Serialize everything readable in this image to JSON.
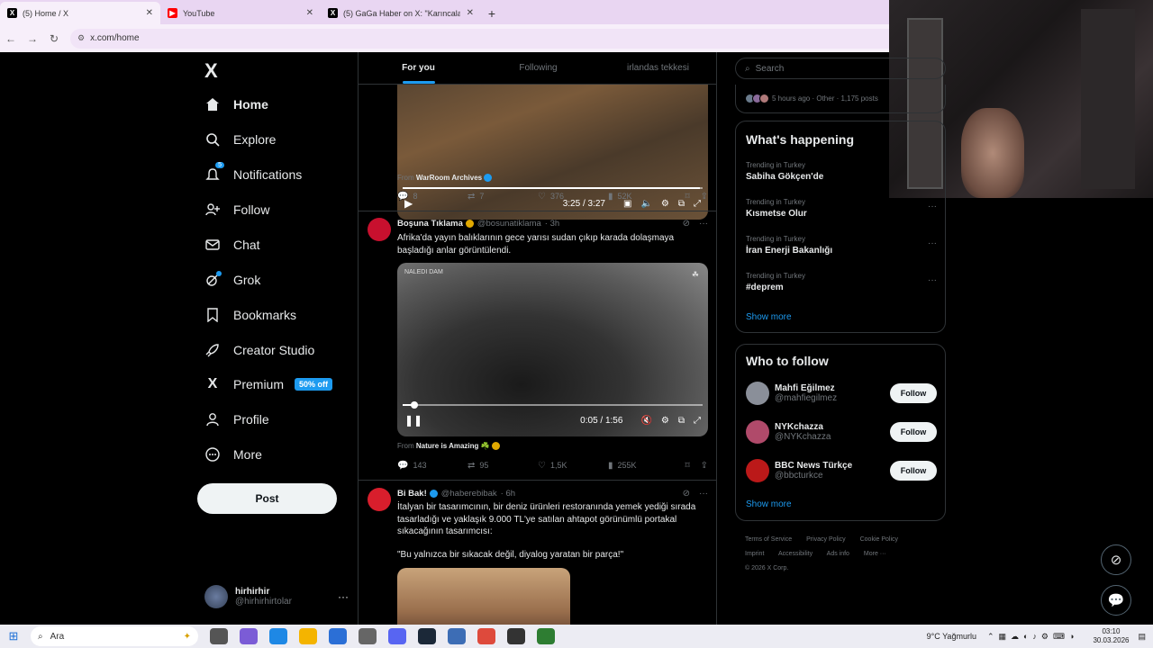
{
  "browser": {
    "tabs": [
      {
        "title": "(5) Home / X",
        "favicon": "X",
        "color": "#000000"
      },
      {
        "title": "YouTube",
        "favicon": "▶",
        "color": "#ff0000"
      },
      {
        "title": "(5) GaGa Haber on X: \"Karıncala...",
        "favicon": "X",
        "color": "#000000"
      }
    ],
    "url": "x.com/home"
  },
  "nav": {
    "logo": "X",
    "items": [
      {
        "label": "Home",
        "icon": "home-icon"
      },
      {
        "label": "Explore",
        "icon": "search-icon"
      },
      {
        "label": "Notifications",
        "icon": "bell-icon",
        "badge": "5"
      },
      {
        "label": "Follow",
        "icon": "add-person-icon"
      },
      {
        "label": "Chat",
        "icon": "mail-icon"
      },
      {
        "label": "Grok",
        "icon": "grok-icon"
      },
      {
        "label": "Bookmarks",
        "icon": "bookmark-icon"
      },
      {
        "label": "Creator Studio",
        "icon": "rocket-icon"
      },
      {
        "label": "Premium",
        "icon": "x-icon",
        "badge": "50% off"
      },
      {
        "label": "Profile",
        "icon": "person-icon"
      },
      {
        "label": "More",
        "icon": "more-circle-icon"
      }
    ],
    "post_label": "Post",
    "account": {
      "name": "hirhirhir",
      "handle": "@hirhirhirtolar"
    }
  },
  "feed": {
    "tabs": [
      "For you",
      "Following",
      "irlandas tekkesi"
    ],
    "tweet1": {
      "video_time": "3:25 / 3:27",
      "video_progress": 0.99,
      "from_label": "From",
      "from_source": "WarRoom Archives",
      "replies": "8",
      "reposts": "7",
      "likes": "376",
      "views": "52K"
    },
    "tweet2": {
      "name": "Boşuna Tıklama",
      "handle": "@bosunatiklama",
      "time": "· 3h",
      "text": "Afrika'da yayın balıklarının gece yarısı sudan çıkıp karada dolaşmaya başladığı anlar görüntülendi.",
      "video_label": "NALEDI DAM",
      "video_time": "0:05 / 1:56",
      "video_progress": 0.04,
      "from_label": "From",
      "from_source": "Nature is Amazing ☘️",
      "replies": "143",
      "reposts": "95",
      "likes": "1,5K",
      "views": "255K"
    },
    "tweet3": {
      "name": "Bi Bak!",
      "handle": "@haberebibak",
      "time": "· 6h",
      "text": "İtalyan bir tasarımcının, bir deniz ürünleri restoranında yemek yediği sırada tasarladığı ve yaklaşık 9.000 TL'ye satılan ahtapot görünümlü portakal sıkacağının tasarımcısı:",
      "quote": "\"Bu yalnızca bir sıkacak değil, diyalog yaratan bir parça!\""
    }
  },
  "right": {
    "search_placeholder": "Search",
    "live_meta": "5 hours ago · Other · 1,175 posts",
    "happening_title": "What's happening",
    "trends": [
      {
        "context": "Trending in Turkey",
        "name": "Sabiha Gökçen'de"
      },
      {
        "context": "Trending in Turkey",
        "name": "Kısmetse Olur"
      },
      {
        "context": "Trending in Turkey",
        "name": "İran Enerji Bakanlığı"
      },
      {
        "context": "Trending in Turkey",
        "name": "#deprem"
      }
    ],
    "show_more": "Show more",
    "who_title": "Who to follow",
    "who": [
      {
        "name": "Mahfi Eğilmez",
        "handle": "@mahfiegilmez",
        "color": "#8a8f99"
      },
      {
        "name": "NYKchazza",
        "handle": "@NYKchazza",
        "color": "#b04a6a"
      },
      {
        "name": "BBC News Türkçe",
        "handle": "@bbcturkce",
        "color": "#bb1919"
      }
    ],
    "follow_label": "Follow",
    "footer": [
      "Terms of Service",
      "Privacy Policy",
      "Cookie Policy",
      "Imprint",
      "Accessibility",
      "Ads info",
      "More ···",
      "© 2026 X Corp."
    ]
  },
  "taskbar": {
    "search": "Ara",
    "weather": "9°C  Yağmurlu",
    "time": "03:10",
    "date": "30.03.2026"
  }
}
